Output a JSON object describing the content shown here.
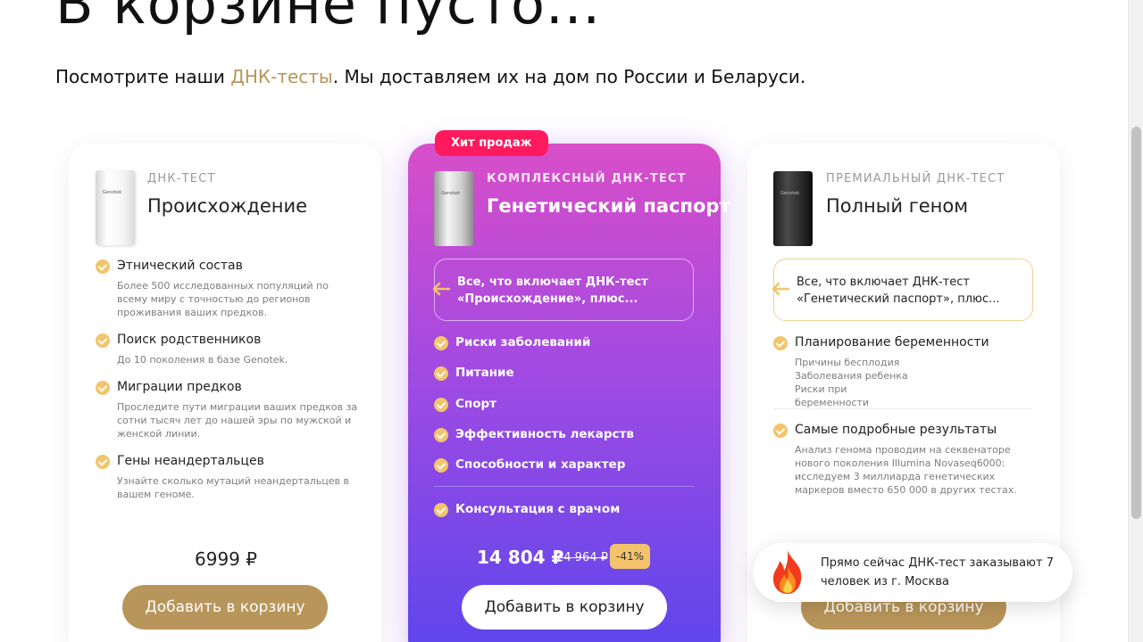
{
  "header": {
    "title": "В корзине пусто...",
    "subtitle_before": "Посмотрите наши ",
    "subtitle_link": "ДНК-тесты",
    "subtitle_after": ". Мы доставляем их на дом по России и Беларуси."
  },
  "colors": {
    "accent_gold": "#b8955a",
    "badge_pink": "#ff1a5e",
    "check_yellow": "#f3c46c",
    "gradient_top": "#d84ec8",
    "gradient_bottom": "#5b46ec"
  },
  "products": [
    {
      "box_label": "Genotek",
      "eyebrow": "ДНК-ТЕСТ",
      "name": "Происхождение",
      "features": [
        {
          "title": "Этнический состав",
          "desc": "Более 500 исследованных популяций по всему миру с точностью до регионов проживания ваших предков."
        },
        {
          "title": "Поиск родственников",
          "desc": "До 10 поколения в базе Genotek."
        },
        {
          "title": "Миграции предков",
          "desc": "Проследите пути миграции ваших предков за сотни тысяч лет до нашей эры по мужской и женской линии."
        },
        {
          "title": "Гены неандертальцев",
          "desc": "Узнайте сколько мутаций неандертальцев в вашем геноме."
        }
      ],
      "price": "6999 ₽",
      "button": "Добавить в корзину"
    },
    {
      "badge": "Хит продаж",
      "box_label": "Genotek",
      "eyebrow": "КОМПЛЕКСНЫЙ ДНК-ТЕСТ",
      "name": "Генетический паспорт",
      "callout": "Все, что включает ДНК-тест «Происхождение», плюс...",
      "features": [
        {
          "title": "Риски заболеваний"
        },
        {
          "title": "Питание"
        },
        {
          "title": "Спорт"
        },
        {
          "title": "Эффективность лекарств"
        },
        {
          "title": "Способности и характер"
        },
        {
          "title": "Консультация с врачом"
        }
      ],
      "price": "14 804 ₽",
      "old_price": "24 964 ₽",
      "discount": "-41%",
      "button": "Добавить в корзину"
    },
    {
      "box_label": "Genotek",
      "eyebrow": "ПРЕМИАЛЬНЫЙ ДНК-ТЕСТ",
      "name": "Полный геном",
      "callout": "Все, что включает ДНК-тест «Генетический паспорт», плюс...",
      "features": [
        {
          "title": "Планирование беременности",
          "desc": "Причины бесплодия Заболевания ребенка Риски при беременности"
        },
        {
          "title": "Самые подробные результаты",
          "desc": "Анализ генома проводим на секвенаторе нового поколения Illumina Novaseq6000: исследуем 3 миллиарда генетических маркеров вместо 650 000 в других тестах."
        }
      ],
      "button": "Добавить в корзину"
    }
  ],
  "toast": {
    "icon": "fire-icon",
    "text": "Прямо сейчас ДНК-тест заказывают 7 человек  из г. Москва"
  }
}
